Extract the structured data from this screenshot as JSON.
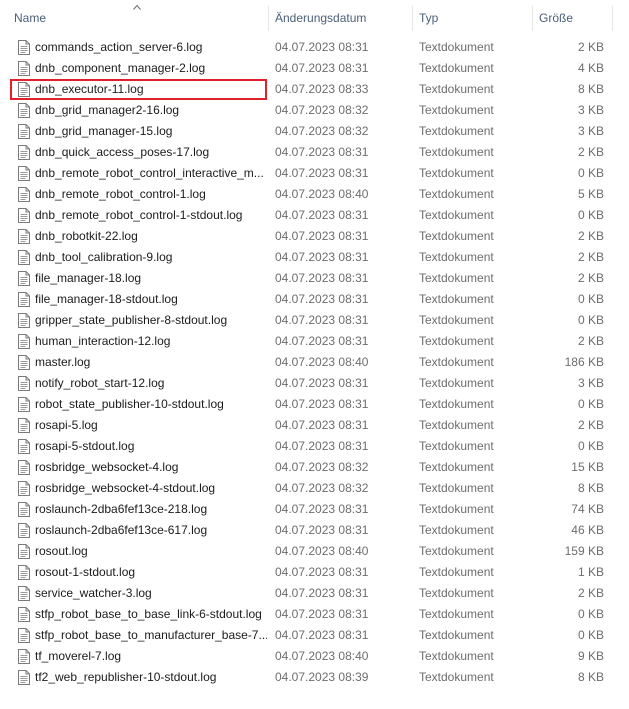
{
  "columns": {
    "name": "Name",
    "date": "Änderungsdatum",
    "type": "Typ",
    "size": "Größe"
  },
  "files": [
    {
      "name": "commands_action_server-6.log",
      "date": "04.07.2023 08:31",
      "type": "Textdokument",
      "size": "2 KB"
    },
    {
      "name": "dnb_component_manager-2.log",
      "date": "04.07.2023 08:31",
      "type": "Textdokument",
      "size": "4 KB"
    },
    {
      "name": "dnb_executor-11.log",
      "date": "04.07.2023 08:33",
      "type": "Textdokument",
      "size": "8 KB",
      "highlighted": true
    },
    {
      "name": "dnb_grid_manager2-16.log",
      "date": "04.07.2023 08:32",
      "type": "Textdokument",
      "size": "3 KB"
    },
    {
      "name": "dnb_grid_manager-15.log",
      "date": "04.07.2023 08:32",
      "type": "Textdokument",
      "size": "3 KB"
    },
    {
      "name": "dnb_quick_access_poses-17.log",
      "date": "04.07.2023 08:31",
      "type": "Textdokument",
      "size": "2 KB"
    },
    {
      "name": "dnb_remote_robot_control_interactive_m...",
      "date": "04.07.2023 08:31",
      "type": "Textdokument",
      "size": "0 KB"
    },
    {
      "name": "dnb_remote_robot_control-1.log",
      "date": "04.07.2023 08:40",
      "type": "Textdokument",
      "size": "5 KB"
    },
    {
      "name": "dnb_remote_robot_control-1-stdout.log",
      "date": "04.07.2023 08:31",
      "type": "Textdokument",
      "size": "0 KB"
    },
    {
      "name": "dnb_robotkit-22.log",
      "date": "04.07.2023 08:31",
      "type": "Textdokument",
      "size": "2 KB"
    },
    {
      "name": "dnb_tool_calibration-9.log",
      "date": "04.07.2023 08:31",
      "type": "Textdokument",
      "size": "2 KB"
    },
    {
      "name": "file_manager-18.log",
      "date": "04.07.2023 08:31",
      "type": "Textdokument",
      "size": "2 KB"
    },
    {
      "name": "file_manager-18-stdout.log",
      "date": "04.07.2023 08:31",
      "type": "Textdokument",
      "size": "0 KB"
    },
    {
      "name": "gripper_state_publisher-8-stdout.log",
      "date": "04.07.2023 08:31",
      "type": "Textdokument",
      "size": "0 KB"
    },
    {
      "name": "human_interaction-12.log",
      "date": "04.07.2023 08:31",
      "type": "Textdokument",
      "size": "2 KB"
    },
    {
      "name": "master.log",
      "date": "04.07.2023 08:40",
      "type": "Textdokument",
      "size": "186 KB"
    },
    {
      "name": "notify_robot_start-12.log",
      "date": "04.07.2023 08:31",
      "type": "Textdokument",
      "size": "3 KB"
    },
    {
      "name": "robot_state_publisher-10-stdout.log",
      "date": "04.07.2023 08:31",
      "type": "Textdokument",
      "size": "0 KB"
    },
    {
      "name": "rosapi-5.log",
      "date": "04.07.2023 08:31",
      "type": "Textdokument",
      "size": "2 KB"
    },
    {
      "name": "rosapi-5-stdout.log",
      "date": "04.07.2023 08:31",
      "type": "Textdokument",
      "size": "0 KB"
    },
    {
      "name": "rosbridge_websocket-4.log",
      "date": "04.07.2023 08:32",
      "type": "Textdokument",
      "size": "15 KB"
    },
    {
      "name": "rosbridge_websocket-4-stdout.log",
      "date": "04.07.2023 08:32",
      "type": "Textdokument",
      "size": "8 KB"
    },
    {
      "name": "roslaunch-2dba6fef13ce-218.log",
      "date": "04.07.2023 08:31",
      "type": "Textdokument",
      "size": "74 KB"
    },
    {
      "name": "roslaunch-2dba6fef13ce-617.log",
      "date": "04.07.2023 08:31",
      "type": "Textdokument",
      "size": "46 KB"
    },
    {
      "name": "rosout.log",
      "date": "04.07.2023 08:40",
      "type": "Textdokument",
      "size": "159 KB"
    },
    {
      "name": "rosout-1-stdout.log",
      "date": "04.07.2023 08:31",
      "type": "Textdokument",
      "size": "1 KB"
    },
    {
      "name": "service_watcher-3.log",
      "date": "04.07.2023 08:31",
      "type": "Textdokument",
      "size": "2 KB"
    },
    {
      "name": "stfp_robot_base_to_base_link-6-stdout.log",
      "date": "04.07.2023 08:31",
      "type": "Textdokument",
      "size": "0 KB"
    },
    {
      "name": "stfp_robot_base_to_manufacturer_base-7...",
      "date": "04.07.2023 08:31",
      "type": "Textdokument",
      "size": "0 KB"
    },
    {
      "name": "tf_moverel-7.log",
      "date": "04.07.2023 08:40",
      "type": "Textdokument",
      "size": "9 KB"
    },
    {
      "name": "tf2_web_republisher-10-stdout.log",
      "date": "04.07.2023 08:39",
      "type": "Textdokument",
      "size": "8 KB"
    }
  ],
  "icons": {
    "sort": "sort-ascending-icon",
    "file": "text-file-icon"
  },
  "colors": {
    "highlight": "#e0202a",
    "header_text": "#4c607a"
  }
}
